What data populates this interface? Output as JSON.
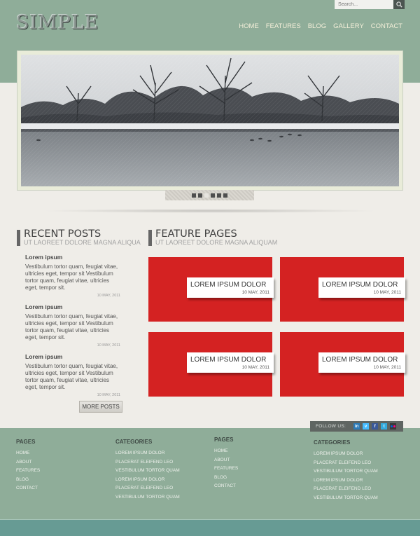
{
  "header": {
    "logo": "SIMPLE",
    "search_placeholder": "Search...",
    "nav": [
      "HOME",
      "FEATURES",
      "BLOG",
      "GALLERY",
      "CONTACT"
    ]
  },
  "slider": {
    "dot_count": 6,
    "active_index": 2
  },
  "recent_posts": {
    "title": "RECENT POSTS",
    "subtitle": "UT LAOREET DOLORE MAGNA ALIQUA",
    "posts": [
      {
        "title": "Lorem ipsum",
        "text": "Vestibulum tortor quam, feugiat vitae, ultricies eget, tempor sit Vestibulum tortor quam, feugiat vitae, ultricies eget, tempor sit.",
        "date": "10 MAY, 2011"
      },
      {
        "title": "Lorem ipsum",
        "text": "Vestibulum tortor quam, feugiat vitae, ultricies eget, tempor sit Vestibulum tortor quam, feugiat vitae, ultricies eget, tempor sit.",
        "date": "10 MAY, 2011"
      },
      {
        "title": "Lorem ipsum",
        "text": "Vestibulum tortor quam, feugiat vitae, ultricies eget, tempor sit Vestibulum tortor quam, feugiat vitae, ultricies eget, tempor sit.",
        "date": "10 MAY, 2011"
      }
    ],
    "more_label": "MORE POSTS"
  },
  "feature_pages": {
    "title": "FEATURE PAGES",
    "subtitle": "UT LAOREET DOLORE MAGNA ALIQUAM",
    "tiles": [
      {
        "title": "LOREM IPSUM DOLOR",
        "date": "10 MAY, 2011"
      },
      {
        "title": "LOREM IPSUM DOLOR",
        "date": "10 MAY, 2011"
      },
      {
        "title": "LOREM IPSUM DOLOR",
        "date": "10 MAY, 2011"
      },
      {
        "title": "LOREM IPSUM DOLOR",
        "date": "10 MAY, 2011"
      }
    ]
  },
  "footer": {
    "follow_label": "FOLLOW US:",
    "social_icons": [
      "linkedin-icon",
      "vimeo-icon",
      "facebook-icon",
      "twitter-icon",
      "flickr-icon"
    ],
    "columns": [
      {
        "title": "PAGES",
        "links": [
          "HOME",
          "ABOUT",
          "FEATURES",
          "BLOG",
          "CONTACT"
        ]
      },
      {
        "title": "CATEGORIES",
        "links": [
          "LOREM IPSUM DOLOR",
          "PLACERAT ELEIFEND LEO",
          "VESTIBULUM TORTOR QUAM",
          "LOREM IPSUM DOLOR",
          "PLACERAT ELEIFEND LEO",
          "VESTIBULUM TORTOR QUAM"
        ]
      },
      {
        "title": "PAGES",
        "links": [
          "HOME",
          "ABOUT",
          "FEATURES",
          "BLOG",
          "CONTACT"
        ]
      },
      {
        "title": "CATEGORIES",
        "links": [
          "LOREM IPSUM DOLOR",
          "PLACERAT ELEIFEND LEO",
          "VESTIBULUM TORTOR QUAM",
          "LOREM IPSUM DOLOR",
          "PLACERAT ELEIFEND LEO",
          "VESTIBULUM TORTOR QUAM"
        ]
      }
    ]
  },
  "colors": {
    "header_green": "#8fad99",
    "tile_red": "#d42222",
    "footer_band": "#679b94"
  }
}
